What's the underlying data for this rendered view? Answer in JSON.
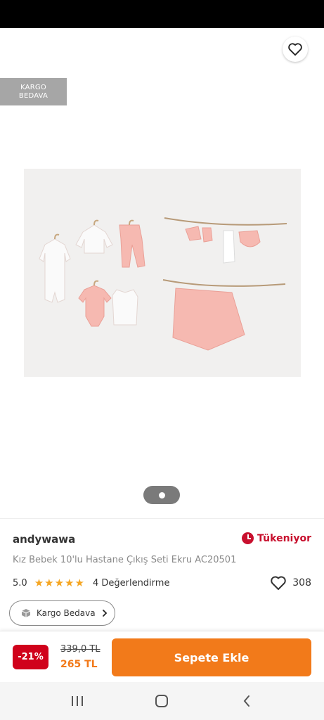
{
  "header": {
    "back_icon": "arrow-left-icon",
    "share_icon": "share-icon",
    "favorite_icon": "heart-outline-icon"
  },
  "image": {
    "badge_line1": "KARGO",
    "badge_line2": "BEDAVA",
    "pager": {
      "count": 1,
      "active": 1
    }
  },
  "product": {
    "brand": "andywawa",
    "stock_label": "Tükeniyor",
    "stock_icon": "clock-icon",
    "name": "Kız Bebek 10'lu Hastane Çıkış Seti Ekru AC20501",
    "rating": "5.0",
    "stars": 5,
    "reviews": "4 Değerlendirme",
    "favorites": "308",
    "cargo_chip": "Kargo Bedava"
  },
  "purchase": {
    "discount": "-21%",
    "old_price": "339,0 TL",
    "new_price": "265 TL",
    "add_to_cart": "Sepete Ekle"
  },
  "colors": {
    "accent": "#f27a1a",
    "discount": "#d0021b",
    "stock": "#c8102e",
    "star": "#f5a623"
  },
  "system_nav": {
    "recent_icon": "recent-apps-icon",
    "home_icon": "home-icon",
    "back_icon": "back-icon"
  }
}
